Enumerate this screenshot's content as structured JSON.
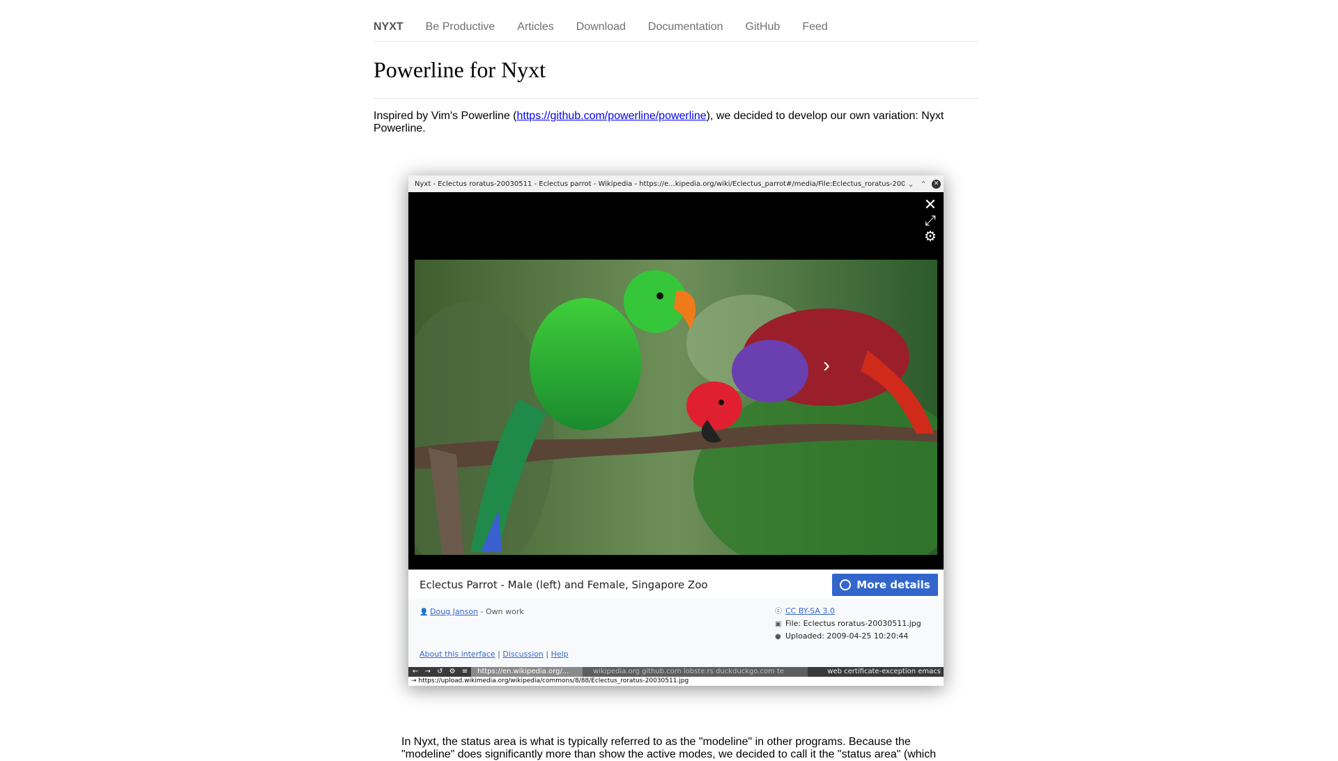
{
  "nav": {
    "brand": "NYXT",
    "links": [
      "Be Productive",
      "Articles",
      "Download",
      "Documentation",
      "GitHub",
      "Feed"
    ]
  },
  "title": "Powerline for Nyxt",
  "intro": {
    "before": "Inspired by Vim's Powerline (",
    "link": "https://github.com/powerline/powerline",
    "after": "), we decided to develop our own variation: Nyxt Powerline."
  },
  "screenshot": {
    "window_title": "Nyxt - Eclectus roratus-20030511 - Eclectus parrot - Wikipedia - https://e...kipedia.org/wiki/Eclectus_parrot#/media/File:Eclectus_roratus-20030511.jpg",
    "viewer_icons": [
      "close-icon",
      "expand-icon",
      "gear-icon",
      "chevron-right-icon"
    ],
    "caption": "Eclectus Parrot - Male (left) and Female, Singapore Zoo",
    "more_details": "More details",
    "author": "Doug Janson",
    "author_suffix": " - Own work",
    "license": "CC BY-SA 3.0",
    "file": "File: Eclectus roratus-20030511.jpg",
    "uploaded": "Uploaded: 2009-04-25 10:20:44",
    "links": {
      "about": "About this interface",
      "discussion": "Discussion",
      "help": "Help",
      "sep": " | "
    },
    "status": {
      "nav_buttons": "← → ↺ ⚙ ≡",
      "url": "https://en.wikipedia.org/...",
      "tabs": "wikipedia.org  github.com  lobste.rs  duckduckgo.com  te",
      "modes": "web certificate-exception emacs"
    },
    "message": "→ https://upload.wikimedia.org/wikipedia/commons/8/88/Eclectus_roratus-20030511.jpg"
  },
  "paragraph": "In Nyxt, the status area is what is typically referred to as the \"modeline\" in other programs. Because the \"modeline\" does significantly more than show the active modes, we decided to call it the \"status area\" (which"
}
